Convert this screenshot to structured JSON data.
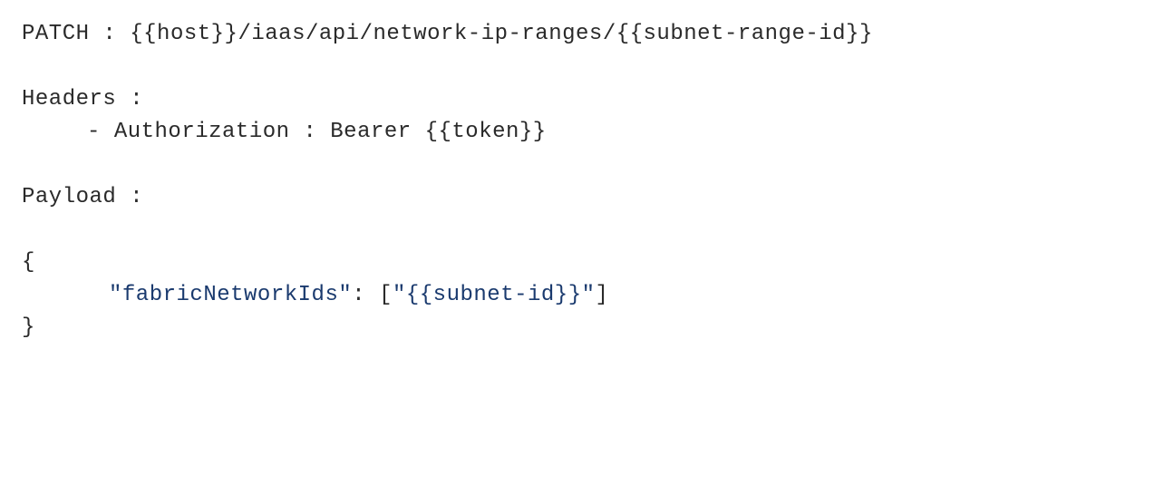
{
  "request": {
    "method": "PATCH",
    "separator": " : ",
    "url": "{{host}}/iaas/api/network-ip-ranges/{{subnet-range-id}}"
  },
  "headers": {
    "label": "Headers :",
    "items": [
      {
        "prefix": "- ",
        "name": "Authorization",
        "separator": " : ",
        "value": "Bearer {{token}}"
      }
    ]
  },
  "payload": {
    "label": "Payload :",
    "json": {
      "open_brace": "{",
      "key_quoted": "\"fabricNetworkIds\"",
      "colon": ": ",
      "array_open": "[",
      "value_quoted": "\"{{subnet-id}}\"",
      "array_close": "]",
      "close_brace": "}"
    }
  }
}
